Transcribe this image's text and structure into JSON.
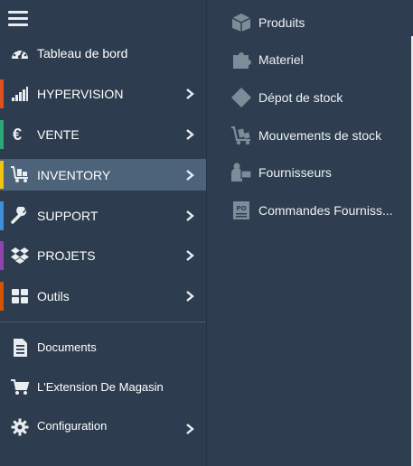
{
  "sidebar": {
    "items": [
      {
        "label": "Tableau de bord",
        "icon": "dashboard-icon"
      },
      {
        "label": "HYPERVISION",
        "icon": "signal-bars-icon",
        "accent": "#e0501f"
      },
      {
        "label": "VENTE",
        "icon": "euro-icon",
        "accent": "#2aa876"
      },
      {
        "label": "INVENTORY",
        "icon": "dolly-icon",
        "accent": "#f1c40f"
      },
      {
        "label": "SUPPORT",
        "icon": "wrench-icon",
        "accent": "#3d8fd8"
      },
      {
        "label": "PROJETS",
        "icon": "dropbox-icon",
        "accent": "#8e44ad"
      },
      {
        "label": "Outils",
        "icon": "grid-icon",
        "accent": "#d35400"
      },
      {
        "label": "Documents",
        "icon": "document-icon"
      },
      {
        "label": "L'Extension De Magasin",
        "icon": "cart-icon"
      },
      {
        "label": "Configuration",
        "icon": "gear-icon"
      }
    ]
  },
  "submenu": {
    "items": [
      {
        "label": "Produits",
        "icon": "box-icon"
      },
      {
        "label": "Materiel",
        "icon": "puzzle-icon"
      },
      {
        "label": "Dépot de stock",
        "icon": "diamond-icon"
      },
      {
        "label": "Mouvements de stock",
        "icon": "dolly-icon"
      },
      {
        "label": "Fournisseurs",
        "icon": "supplier-icon"
      },
      {
        "label": "Commandes Fourniss...",
        "icon": "po-icon"
      }
    ]
  },
  "colors": {
    "sidebar_bg": "#2d3d4f",
    "active_bg": "#4d6379",
    "submenu_icon": "#7e8c99"
  }
}
